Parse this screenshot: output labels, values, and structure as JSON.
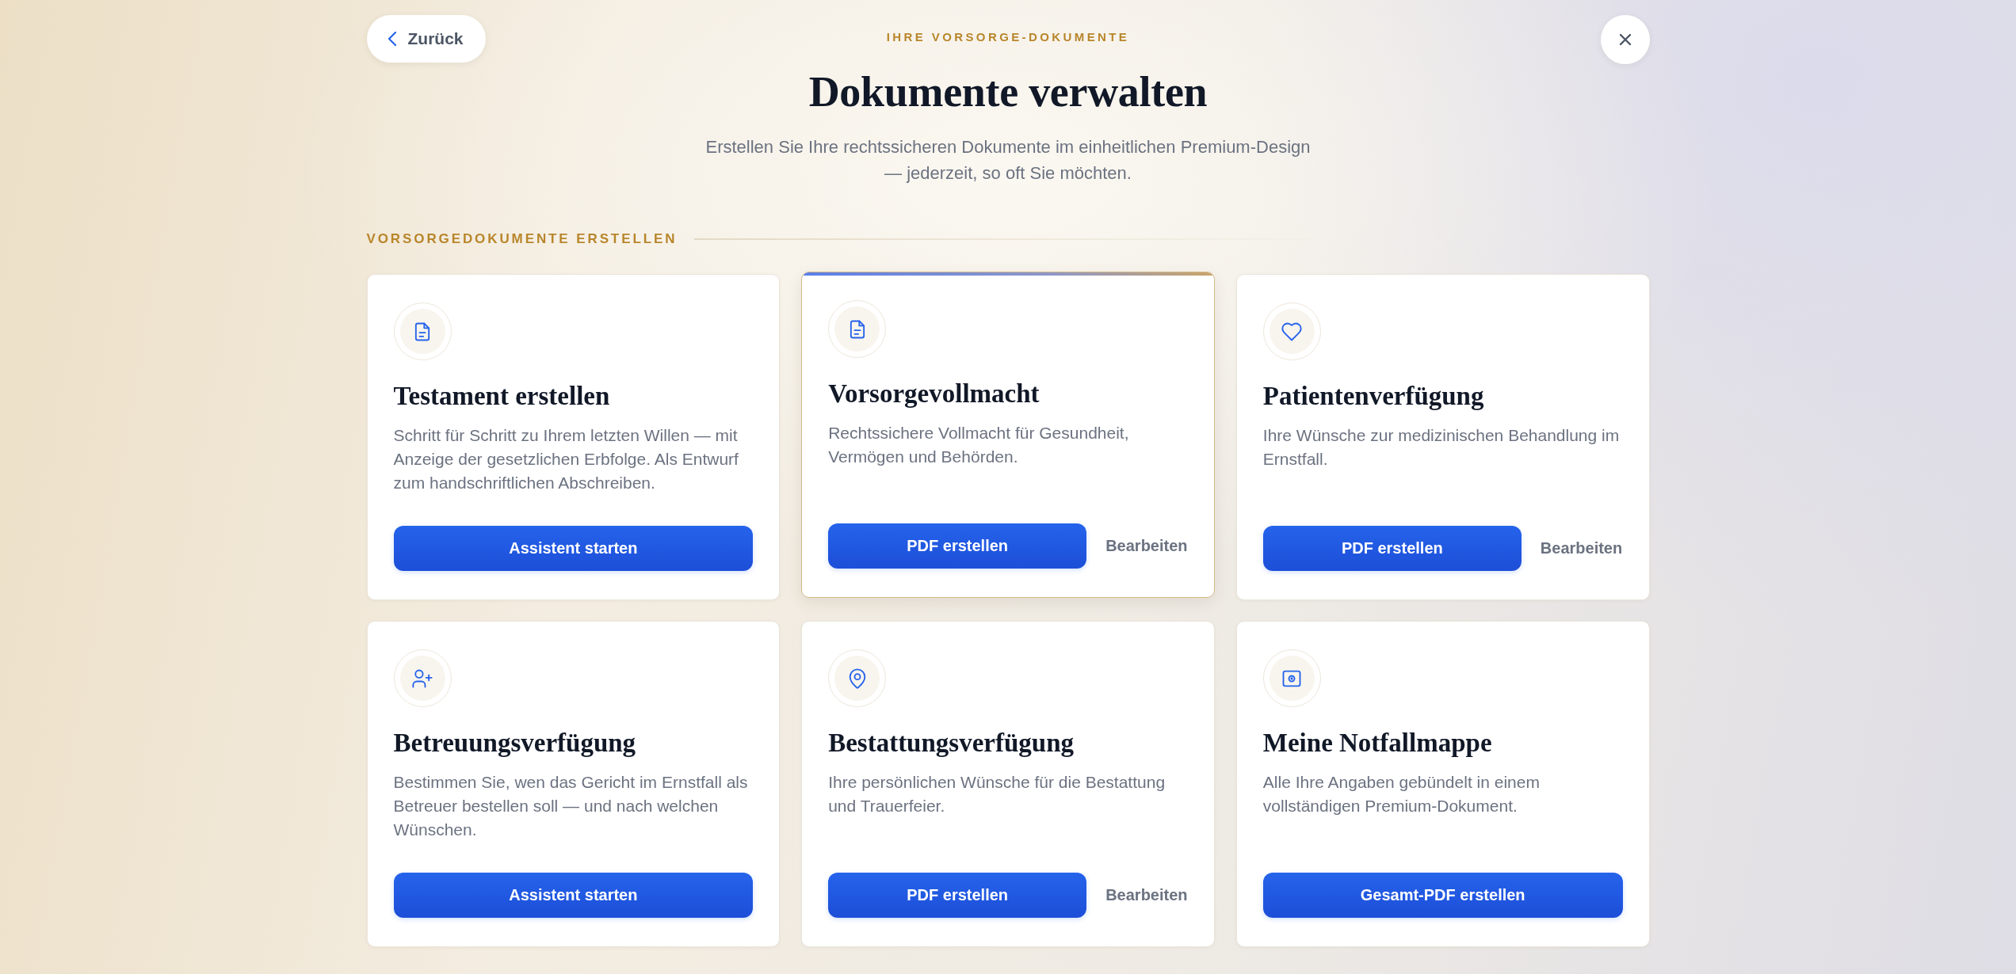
{
  "header": {
    "back_button": {
      "label": "Zurück"
    },
    "eyebrow": "IHRE VORSORGE-DOKUMENTE",
    "title": "Dokumente verwalten",
    "subtitle": "Erstellen Sie Ihre rechtssicheren Dokumente im einheitlichen Premium-Design — jederzeit, so oft Sie möchten."
  },
  "section": {
    "heading": "VORSORGEDOKUMENTE ERSTELLEN",
    "cards": [
      {
        "title": "Testament erstellen",
        "description": "Schritt für Schritt zu Ihrem letzten Willen — mit Anzeige der gesetzlichen Erbfolge. Als Entwurf zum handschriftlichen Abschreiben.",
        "highlighted": false,
        "actions": [
          {
            "kind": "primary",
            "label": "Assistent starten"
          }
        ]
      },
      {
        "title": "Vorsorgevollmacht",
        "description": "Rechtssichere Vollmacht für Gesundheit, Vermögen und Behörden.",
        "highlighted": true,
        "actions": [
          {
            "kind": "primary",
            "label": "PDF erstellen"
          },
          {
            "kind": "link",
            "label": "Bearbeiten"
          }
        ]
      },
      {
        "title": "Patientenverfügung",
        "description": "Ihre Wünsche zur medizinischen Behandlung im Ernstfall.",
        "highlighted": false,
        "actions": [
          {
            "kind": "primary",
            "label": "PDF erstellen"
          },
          {
            "kind": "link",
            "label": "Bearbeiten"
          }
        ]
      },
      {
        "title": "Betreuungsverfügung",
        "description": "Bestimmen Sie, wen das Gericht im Ernstfall als Betreuer bestellen soll — und nach welchen Wünschen.",
        "highlighted": false,
        "actions": [
          {
            "kind": "primary",
            "label": "Assistent starten"
          }
        ]
      },
      {
        "title": "Bestattungsverfügung",
        "description": "Ihre persönlichen Wünsche für die Bestattung und Trauerfeier.",
        "highlighted": false,
        "actions": [
          {
            "kind": "primary",
            "label": "PDF erstellen"
          },
          {
            "kind": "link",
            "label": "Bearbeiten"
          }
        ]
      },
      {
        "title": "Meine Notfallmappe",
        "description": "Alle Ihre Angaben gebündelt in einem vollständigen Premium-Dokument.",
        "highlighted": false,
        "actions": [
          {
            "kind": "primary",
            "label": "Gesamt-PDF erstellen"
          }
        ]
      }
    ]
  }
}
